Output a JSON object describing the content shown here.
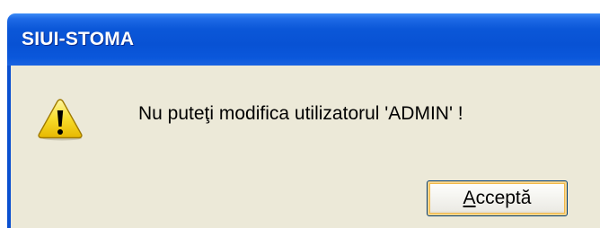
{
  "window": {
    "title": "SIUI-STOMA"
  },
  "dialog": {
    "icon": "warning-icon",
    "message": "Nu puteţi modifica utilizatorul 'ADMIN' !",
    "ok_button": {
      "mnemonic": "A",
      "rest": "cceptă"
    }
  },
  "colors": {
    "titlebar": "#0852d4",
    "client": "#ece9d8",
    "title_text": "#ffffff",
    "warning_fill": "#f5d312"
  }
}
